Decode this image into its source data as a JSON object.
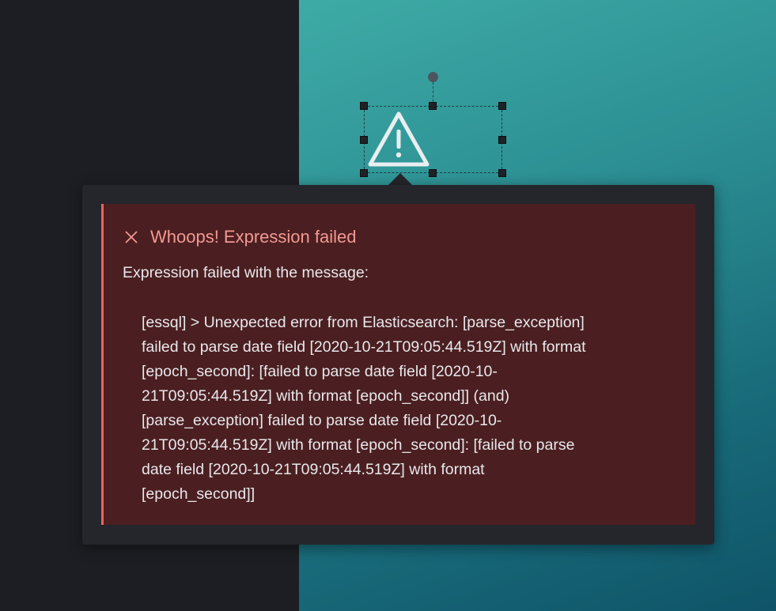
{
  "colors": {
    "left_pane": "#1d1e23",
    "canvas_gradient_start": "#3eaba6",
    "canvas_gradient_end": "#0f5468",
    "popover_bg": "#25262b",
    "callout_bg": "#4b1f21",
    "callout_border": "#e7665f",
    "callout_title": "#f39893",
    "text": "#e8e8ec"
  },
  "canvas_element": {
    "icon": "warning-triangle-icon",
    "selected": true
  },
  "error": {
    "title": "Whoops! Expression failed",
    "message": "Expression failed with the message:",
    "detail": "[essql] > Unexpected error from Elasticsearch: [parse_exception]\nfailed to parse date field [2020-10-21T09:05:44.519Z] with format\n[epoch_second]: [failed to parse date field [2020-10-\n21T09:05:44.519Z] with format [epoch_second]] (and)\n[parse_exception] failed to parse date field [2020-10-\n21T09:05:44.519Z] with format [epoch_second]: [failed to parse\ndate field [2020-10-21T09:05:44.519Z] with format\n[epoch_second]]"
  }
}
